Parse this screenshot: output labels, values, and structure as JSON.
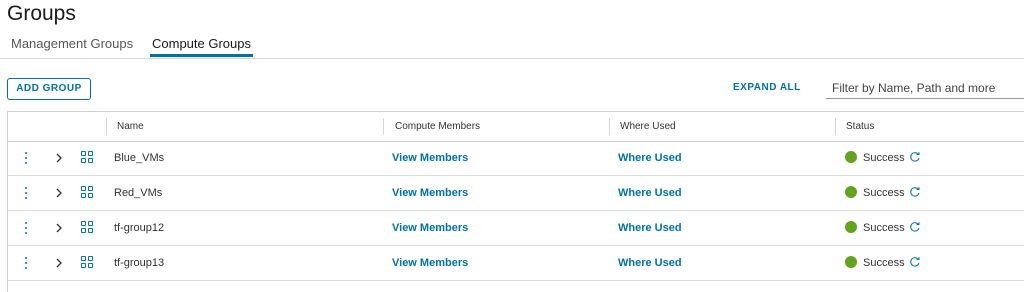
{
  "page": {
    "title": "Groups"
  },
  "tabs": [
    {
      "label": "Management Groups",
      "active": false
    },
    {
      "label": "Compute Groups",
      "active": true
    }
  ],
  "toolbar": {
    "add_label": "ADD GROUP",
    "expand_label": "EXPAND ALL",
    "filter_placeholder": "Filter by Name, Path and more"
  },
  "table": {
    "columns": [
      "Name",
      "Compute Members",
      "Where Used",
      "Status"
    ],
    "rows": [
      {
        "name": "Blue_VMs",
        "members": "View Members",
        "where_used": "Where Used",
        "status": "Success"
      },
      {
        "name": "Red_VMs",
        "members": "View Members",
        "where_used": "Where Used",
        "status": "Success"
      },
      {
        "name": "tf-group12",
        "members": "View Members",
        "where_used": "Where Used",
        "status": "Success"
      },
      {
        "name": "tf-group13",
        "members": "View Members",
        "where_used": "Where Used",
        "status": "Success"
      }
    ]
  },
  "icons": {
    "row_menu": "vertical-ellipsis-icon",
    "expand": "chevron-right-icon",
    "group": "group-icon",
    "status": "success-status-dot",
    "refresh": "refresh-icon"
  },
  "colors": {
    "accent": "#0072a3",
    "success": "#62a420"
  }
}
